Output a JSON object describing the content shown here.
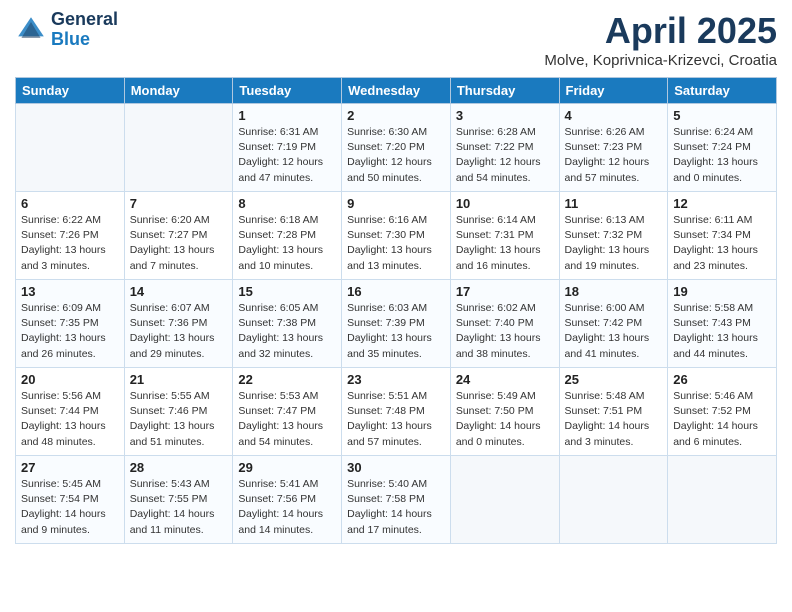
{
  "header": {
    "logo_line1": "General",
    "logo_line2": "Blue",
    "month": "April 2025",
    "location": "Molve, Koprivnica-Krizevci, Croatia"
  },
  "days_of_week": [
    "Sunday",
    "Monday",
    "Tuesday",
    "Wednesday",
    "Thursday",
    "Friday",
    "Saturday"
  ],
  "weeks": [
    [
      {
        "num": "",
        "info": ""
      },
      {
        "num": "",
        "info": ""
      },
      {
        "num": "1",
        "info": "Sunrise: 6:31 AM\nSunset: 7:19 PM\nDaylight: 12 hours\nand 47 minutes."
      },
      {
        "num": "2",
        "info": "Sunrise: 6:30 AM\nSunset: 7:20 PM\nDaylight: 12 hours\nand 50 minutes."
      },
      {
        "num": "3",
        "info": "Sunrise: 6:28 AM\nSunset: 7:22 PM\nDaylight: 12 hours\nand 54 minutes."
      },
      {
        "num": "4",
        "info": "Sunrise: 6:26 AM\nSunset: 7:23 PM\nDaylight: 12 hours\nand 57 minutes."
      },
      {
        "num": "5",
        "info": "Sunrise: 6:24 AM\nSunset: 7:24 PM\nDaylight: 13 hours\nand 0 minutes."
      }
    ],
    [
      {
        "num": "6",
        "info": "Sunrise: 6:22 AM\nSunset: 7:26 PM\nDaylight: 13 hours\nand 3 minutes."
      },
      {
        "num": "7",
        "info": "Sunrise: 6:20 AM\nSunset: 7:27 PM\nDaylight: 13 hours\nand 7 minutes."
      },
      {
        "num": "8",
        "info": "Sunrise: 6:18 AM\nSunset: 7:28 PM\nDaylight: 13 hours\nand 10 minutes."
      },
      {
        "num": "9",
        "info": "Sunrise: 6:16 AM\nSunset: 7:30 PM\nDaylight: 13 hours\nand 13 minutes."
      },
      {
        "num": "10",
        "info": "Sunrise: 6:14 AM\nSunset: 7:31 PM\nDaylight: 13 hours\nand 16 minutes."
      },
      {
        "num": "11",
        "info": "Sunrise: 6:13 AM\nSunset: 7:32 PM\nDaylight: 13 hours\nand 19 minutes."
      },
      {
        "num": "12",
        "info": "Sunrise: 6:11 AM\nSunset: 7:34 PM\nDaylight: 13 hours\nand 23 minutes."
      }
    ],
    [
      {
        "num": "13",
        "info": "Sunrise: 6:09 AM\nSunset: 7:35 PM\nDaylight: 13 hours\nand 26 minutes."
      },
      {
        "num": "14",
        "info": "Sunrise: 6:07 AM\nSunset: 7:36 PM\nDaylight: 13 hours\nand 29 minutes."
      },
      {
        "num": "15",
        "info": "Sunrise: 6:05 AM\nSunset: 7:38 PM\nDaylight: 13 hours\nand 32 minutes."
      },
      {
        "num": "16",
        "info": "Sunrise: 6:03 AM\nSunset: 7:39 PM\nDaylight: 13 hours\nand 35 minutes."
      },
      {
        "num": "17",
        "info": "Sunrise: 6:02 AM\nSunset: 7:40 PM\nDaylight: 13 hours\nand 38 minutes."
      },
      {
        "num": "18",
        "info": "Sunrise: 6:00 AM\nSunset: 7:42 PM\nDaylight: 13 hours\nand 41 minutes."
      },
      {
        "num": "19",
        "info": "Sunrise: 5:58 AM\nSunset: 7:43 PM\nDaylight: 13 hours\nand 44 minutes."
      }
    ],
    [
      {
        "num": "20",
        "info": "Sunrise: 5:56 AM\nSunset: 7:44 PM\nDaylight: 13 hours\nand 48 minutes."
      },
      {
        "num": "21",
        "info": "Sunrise: 5:55 AM\nSunset: 7:46 PM\nDaylight: 13 hours\nand 51 minutes."
      },
      {
        "num": "22",
        "info": "Sunrise: 5:53 AM\nSunset: 7:47 PM\nDaylight: 13 hours\nand 54 minutes."
      },
      {
        "num": "23",
        "info": "Sunrise: 5:51 AM\nSunset: 7:48 PM\nDaylight: 13 hours\nand 57 minutes."
      },
      {
        "num": "24",
        "info": "Sunrise: 5:49 AM\nSunset: 7:50 PM\nDaylight: 14 hours\nand 0 minutes."
      },
      {
        "num": "25",
        "info": "Sunrise: 5:48 AM\nSunset: 7:51 PM\nDaylight: 14 hours\nand 3 minutes."
      },
      {
        "num": "26",
        "info": "Sunrise: 5:46 AM\nSunset: 7:52 PM\nDaylight: 14 hours\nand 6 minutes."
      }
    ],
    [
      {
        "num": "27",
        "info": "Sunrise: 5:45 AM\nSunset: 7:54 PM\nDaylight: 14 hours\nand 9 minutes."
      },
      {
        "num": "28",
        "info": "Sunrise: 5:43 AM\nSunset: 7:55 PM\nDaylight: 14 hours\nand 11 minutes."
      },
      {
        "num": "29",
        "info": "Sunrise: 5:41 AM\nSunset: 7:56 PM\nDaylight: 14 hours\nand 14 minutes."
      },
      {
        "num": "30",
        "info": "Sunrise: 5:40 AM\nSunset: 7:58 PM\nDaylight: 14 hours\nand 17 minutes."
      },
      {
        "num": "",
        "info": ""
      },
      {
        "num": "",
        "info": ""
      },
      {
        "num": "",
        "info": ""
      }
    ]
  ]
}
